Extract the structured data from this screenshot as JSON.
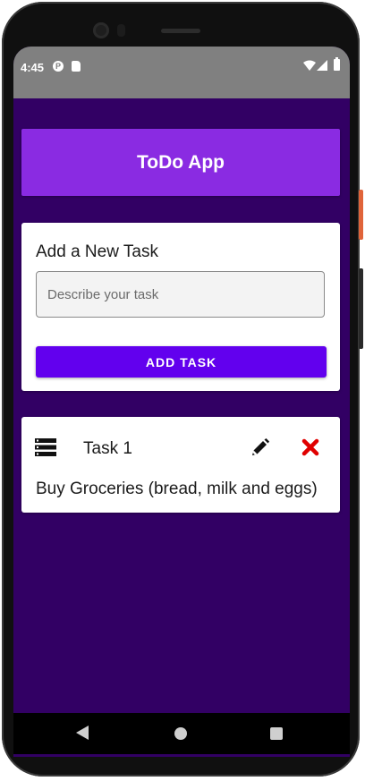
{
  "status_bar": {
    "time": "4:45",
    "icons": [
      "data-saver-icon",
      "sd-card-icon",
      "wifi-icon",
      "signal-icon",
      "battery-icon"
    ]
  },
  "header": {
    "title": "ToDo App",
    "color": "#8a2be2"
  },
  "add_task": {
    "title": "Add a New Task",
    "input_placeholder": "Describe your task",
    "input_value": "",
    "button_label": "ADD TASK",
    "button_color": "#6200ee"
  },
  "tasks": [
    {
      "name": "Task 1",
      "description": "Buy Groceries (bread, milk and eggs)",
      "icons": [
        "list-icon",
        "edit-icon",
        "delete-icon"
      ]
    }
  ],
  "colors": {
    "background": "#320064",
    "delete": "#e00000"
  },
  "nav_bar": {
    "icons": [
      "back-icon",
      "home-icon",
      "recents-icon"
    ]
  }
}
